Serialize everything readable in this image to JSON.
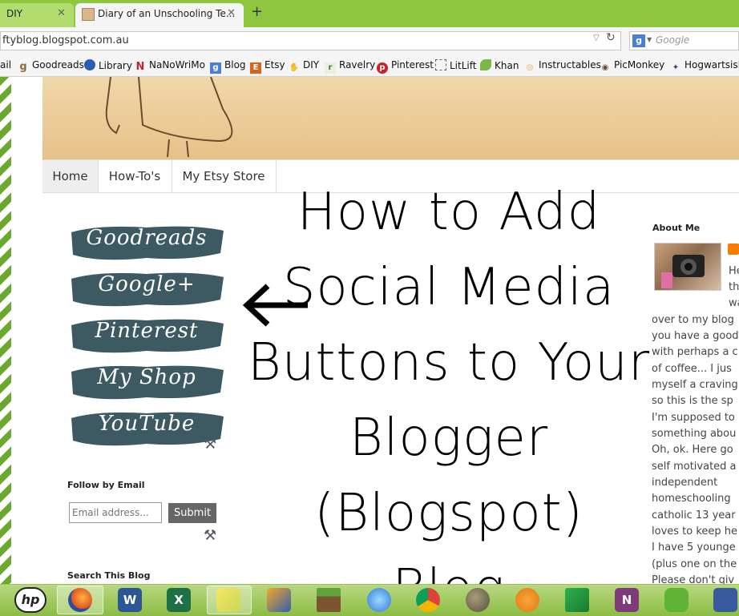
{
  "browser": {
    "tabs": [
      {
        "label": "DIY",
        "active": false
      },
      {
        "label": "Diary of an Unschooling Te...",
        "active": true
      }
    ],
    "new_tab_label": "+",
    "close_glyph": "✕",
    "address": "ftyblog.blogspot.com.au",
    "search_placeholder": "Google",
    "search_engine_glyph": "g",
    "bookmarks": [
      {
        "label": "ail",
        "icon": "mail-icon"
      },
      {
        "label": "Goodreads",
        "icon": "goodreads-icon"
      },
      {
        "label": "Library",
        "icon": "globe-icon"
      },
      {
        "label": "NaNoWriMo",
        "icon": "nanowrimo-icon"
      },
      {
        "label": "Blog",
        "icon": "blogger-icon"
      },
      {
        "label": "Etsy",
        "icon": "etsy-icon"
      },
      {
        "label": "DIY",
        "icon": "hand-icon"
      },
      {
        "label": "Ravelry",
        "icon": "ravelry-icon"
      },
      {
        "label": "Pinterest",
        "icon": "pinterest-icon"
      },
      {
        "label": "LitLift",
        "icon": "dotted-box-icon"
      },
      {
        "label": "Khan",
        "icon": "leaf-icon"
      },
      {
        "label": "Instructables",
        "icon": "instructables-icon"
      },
      {
        "label": "PicMonkey",
        "icon": "picmonkey-icon"
      },
      {
        "label": "HogwartsisH",
        "icon": "hogwarts-icon"
      }
    ]
  },
  "blog": {
    "nav_tabs": [
      "Home",
      "How-To's",
      "My Etsy Store"
    ],
    "social_buttons": [
      "Goodreads",
      "Google+",
      "Pinterest",
      "My Shop",
      "YouTube"
    ],
    "follow_title": "Follow by Email",
    "email_placeholder": "Email address...",
    "submit_label": "Submit",
    "search_title": "Search This Blog",
    "about_title": "About Me",
    "about_lines": [
      "He",
      "th",
      "wa",
      "over to my blog",
      "you have a good",
      "with perhaps a c",
      "of coffee... I jus",
      "myself a craving",
      "so this is the sp",
      "I'm supposed to",
      "something abou",
      "Oh, ok. Here go",
      "self motivated a",
      "independent",
      "homeschooling",
      "catholic 13 year",
      "loves to keep he",
      "I have 5 younge",
      "(plus one on the",
      "Please don't giv"
    ]
  },
  "overlay": {
    "title_lines": [
      "How to Add",
      "Social Media",
      "Buttons to Your",
      "Blogger (Blogspot)",
      "Blog"
    ]
  },
  "colors": {
    "chrome_green": "#8ec63f",
    "brush_teal": "#3d5a63",
    "stripe_green": "#6aa82e"
  },
  "taskbar": {
    "icons": [
      "hp-icon",
      "firefox-icon",
      "word-icon",
      "excel-icon",
      "sticky-notes-icon",
      "media-icon",
      "minecraft-icon",
      "itunes-icon",
      "chrome-icon",
      "gimp-icon",
      "scratch-icon",
      "feedly-icon",
      "onenote-icon",
      "evernote-icon",
      "app-icon"
    ]
  }
}
